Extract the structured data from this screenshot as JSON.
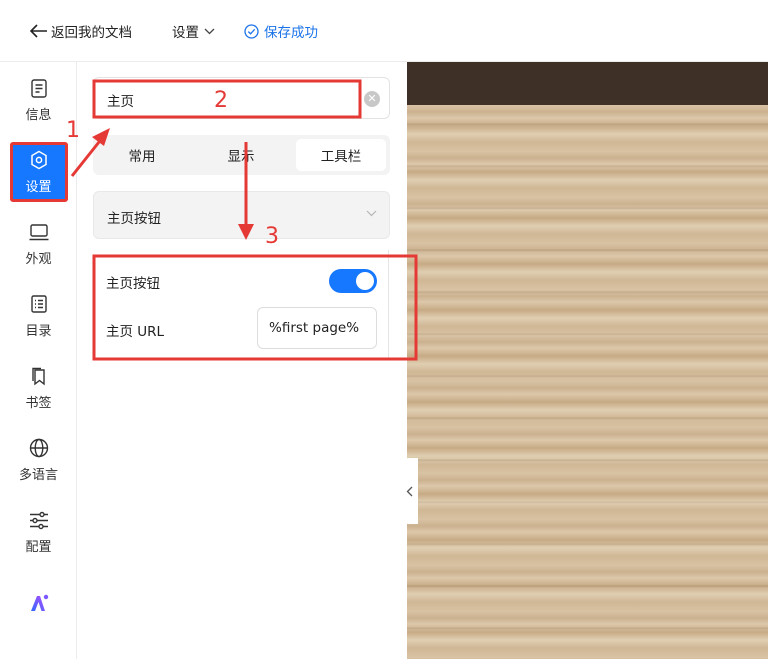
{
  "topbar": {
    "back_label": "返回我的文档",
    "settings_label": "设置",
    "saved_label": "保存成功"
  },
  "sidebar": {
    "items": [
      {
        "label": "信息",
        "icon": "info-doc-icon"
      },
      {
        "label": "设置",
        "icon": "hexagon-settings-icon",
        "active": true
      },
      {
        "label": "外观",
        "icon": "monitor-icon"
      },
      {
        "label": "目录",
        "icon": "list-icon"
      },
      {
        "label": "书签",
        "icon": "bookmark-icon"
      },
      {
        "label": "多语言",
        "icon": "globe-icon"
      },
      {
        "label": "配置",
        "icon": "sliders-icon"
      }
    ],
    "ai_icon": "ai-logo-icon"
  },
  "panel": {
    "search": {
      "value": "主页"
    },
    "tabs": [
      {
        "label": "常用",
        "selected": false
      },
      {
        "label": "显示",
        "selected": false
      },
      {
        "label": "工具栏",
        "selected": true
      }
    ],
    "group_title": "主页按钮",
    "settings": {
      "home_button_label": "主页按钮",
      "home_button_enabled": true,
      "home_url_label": "主页 URL",
      "home_url_value": "%first page%"
    }
  },
  "annotations": {
    "step1": "1",
    "step2": "2",
    "step3": "3",
    "color": "#e53935"
  },
  "colors": {
    "accent": "#1677ff",
    "annotation": "#e53935"
  }
}
